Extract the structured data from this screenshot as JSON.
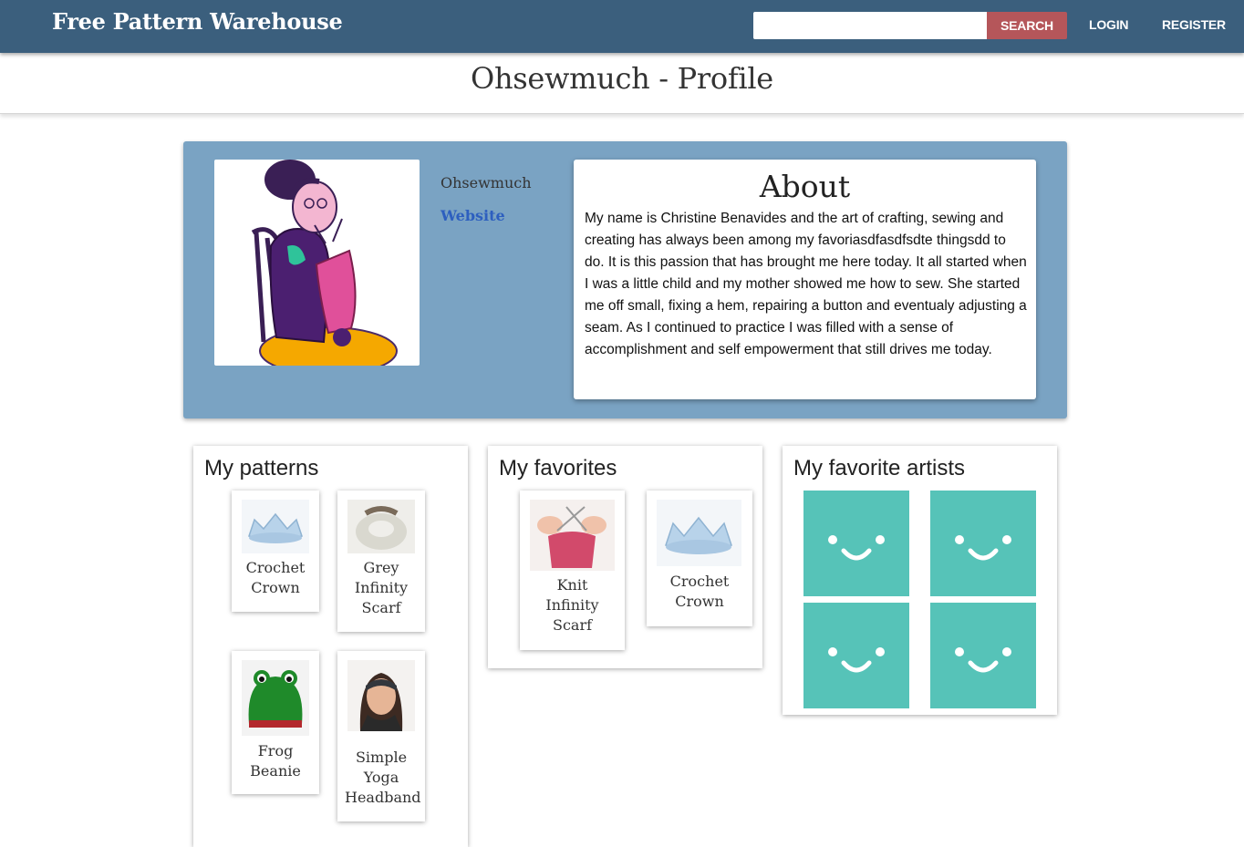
{
  "nav": {
    "brand": "Free Pattern Warehouse",
    "search_value": "",
    "search_button": "SEARCH",
    "login": "LOGIN",
    "register": "REGISTER"
  },
  "page": {
    "title": "Ohsewmuch - Profile"
  },
  "profile": {
    "username": "Ohsewmuch",
    "website_label": "Website",
    "avatar_icon": "knitting-grandma-avatar"
  },
  "about": {
    "title": "About",
    "text": "My name is Christine Benavides and the art of crafting, sewing and creating has always been among my favoriasdfasdfsdte thingsdd to do. It is this passion that has brought me here today. It all started when I was a little child and my mother showed me how to sew. She started me off small, fixing a hem, repairing a button and eventualy adjusting a seam. As I continued to practice I was filled with a sense of accomplishment and self empowerment that still drives me today."
  },
  "patterns": {
    "title": "My patterns",
    "items": [
      {
        "name": "Crochet Crown",
        "icon": "crochet-crown-thumbnail"
      },
      {
        "name": "Grey Infinity Scarf",
        "icon": "grey-scarf-thumbnail"
      },
      {
        "name": "Frog Beanie",
        "icon": "frog-beanie-thumbnail"
      },
      {
        "name": "Simple Yoga Headband",
        "icon": "yoga-headband-thumbnail"
      }
    ]
  },
  "favorites": {
    "title": "My favorites",
    "items": [
      {
        "name": "Knit Infinity Scarf",
        "icon": "knitting-thumbnail"
      },
      {
        "name": "Crochet Crown",
        "icon": "crochet-crown-thumbnail"
      }
    ]
  },
  "artists": {
    "title": "My favorite artists",
    "tiles": [
      {
        "icon": "smiley-avatar-icon"
      },
      {
        "icon": "smiley-avatar-icon"
      },
      {
        "icon": "smiley-avatar-icon"
      },
      {
        "icon": "smiley-avatar-icon"
      }
    ]
  },
  "colors": {
    "navbar": "#3b5f7d",
    "search_button": "#b5565a",
    "profile_card": "#7aa3c3",
    "website_link": "#2d5fbf",
    "artist_tile": "#56c3b8"
  }
}
